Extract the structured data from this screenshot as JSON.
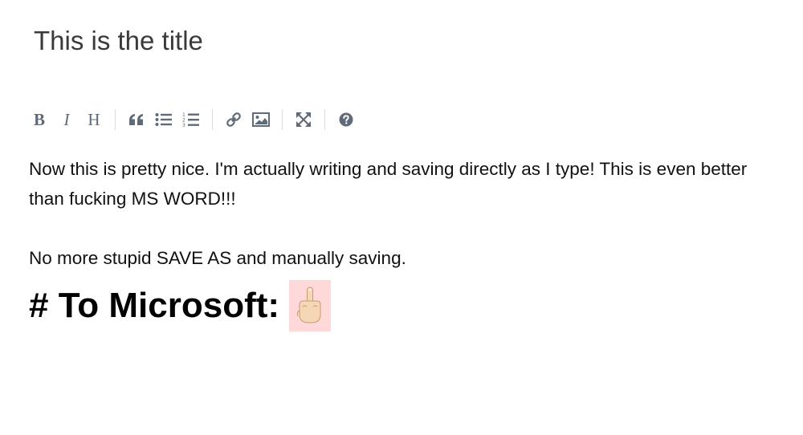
{
  "post": {
    "title_value": "This is the title"
  },
  "toolbar": {
    "bold_label": "B",
    "italic_label": "I",
    "heading_label": "H",
    "icons": [
      "bold-icon",
      "italic-icon",
      "heading-icon",
      "quote-icon",
      "unordered-list-icon",
      "ordered-list-icon",
      "link-icon",
      "image-icon",
      "fullscreen-icon",
      "help-icon"
    ],
    "icon_color": "#5f6b78"
  },
  "editor": {
    "paragraph1": "Now this is pretty nice. I'm actually writing and saving directly as I type! This is even better than fucking MS WORD!!!",
    "paragraph2": "No more stupid SAVE AS and manually saving.",
    "heading": "# To Microsoft:",
    "heading_emoji": "middle-finger-emoji",
    "emoji_highlight_color": "#ffd8da"
  }
}
